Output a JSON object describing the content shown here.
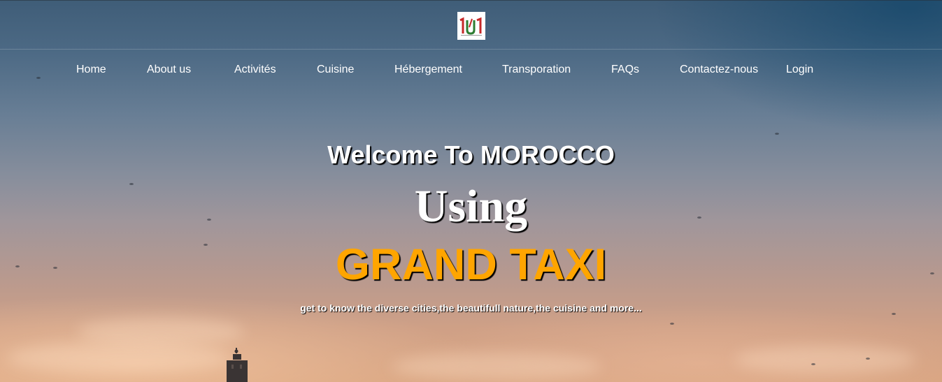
{
  "logo": {
    "alt_text": "logo"
  },
  "nav": {
    "items": [
      {
        "label": "Home"
      },
      {
        "label": "About us"
      },
      {
        "label": "Activités"
      },
      {
        "label": "Cuisine"
      },
      {
        "label": "Hébergement"
      },
      {
        "label": "Transporation"
      },
      {
        "label": "FAQs"
      },
      {
        "label": "Contactez-nous"
      },
      {
        "label": "Login"
      }
    ]
  },
  "hero": {
    "title": "Welcome To MOROCCO",
    "using": "Using",
    "highlight": "GRAND TAXI",
    "subtitle": "get to know the diverse cities,the beautifull nature,the cuisine and more..."
  },
  "colors": {
    "highlight": "#ffa500",
    "text": "#ffffff",
    "logo_green": "#2e7d32",
    "logo_red": "#c62828"
  },
  "icons": {
    "logo": "brand-logo-icon",
    "tower": "minaret-tower-icon"
  }
}
